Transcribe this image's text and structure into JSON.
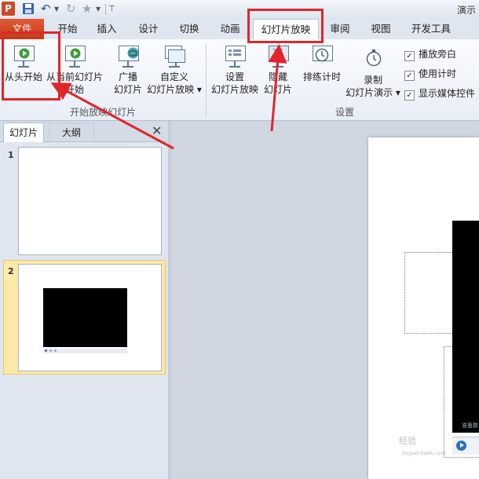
{
  "window": {
    "title": "演示",
    "app_icon_letter": "P"
  },
  "tabs": [
    {
      "id": "file",
      "label": "文件"
    },
    {
      "id": "home",
      "label": "开始"
    },
    {
      "id": "insert",
      "label": "插入"
    },
    {
      "id": "design",
      "label": "设计"
    },
    {
      "id": "transitions",
      "label": "切换"
    },
    {
      "id": "animations",
      "label": "动画"
    },
    {
      "id": "slideshow",
      "label": "幻灯片放映"
    },
    {
      "id": "review",
      "label": "审阅"
    },
    {
      "id": "view",
      "label": "视图"
    },
    {
      "id": "developer",
      "label": "开发工具"
    }
  ],
  "ribbon": {
    "start_group": {
      "label": "开始放映幻灯片",
      "from_beginning": [
        "从头开始"
      ],
      "from_current": [
        "从当前幻灯片",
        "开始"
      ],
      "broadcast": [
        "广播",
        "幻灯片"
      ],
      "custom": [
        "自定义",
        "幻灯片放映 ▾"
      ]
    },
    "setup_group": {
      "label": "设置",
      "setup": [
        "设置",
        "幻灯片放映"
      ],
      "hide": [
        "隐藏",
        "幻灯片"
      ],
      "rehearse": [
        "排练计时"
      ],
      "record": [
        "录制",
        "幻灯片演示 ▾"
      ],
      "checkboxes": [
        {
          "label": "播放旁白",
          "checked": true
        },
        {
          "label": "使用计时",
          "checked": true
        },
        {
          "label": "显示媒体控件",
          "checked": true
        }
      ]
    }
  },
  "left_pane": {
    "tab_slides": "幻灯片",
    "tab_outline": "大纲",
    "close_glyph": "✕",
    "slides": [
      {
        "number": "1"
      },
      {
        "number": "2",
        "selected": true
      }
    ]
  },
  "editor": {
    "video_caption": "准备数",
    "watermark": "经验",
    "watermark_sub": "jingyan.baidu.com"
  },
  "colors": {
    "accent_red": "#e0262b",
    "file_tab": "#d24726",
    "selection": "#fbe9a8"
  }
}
